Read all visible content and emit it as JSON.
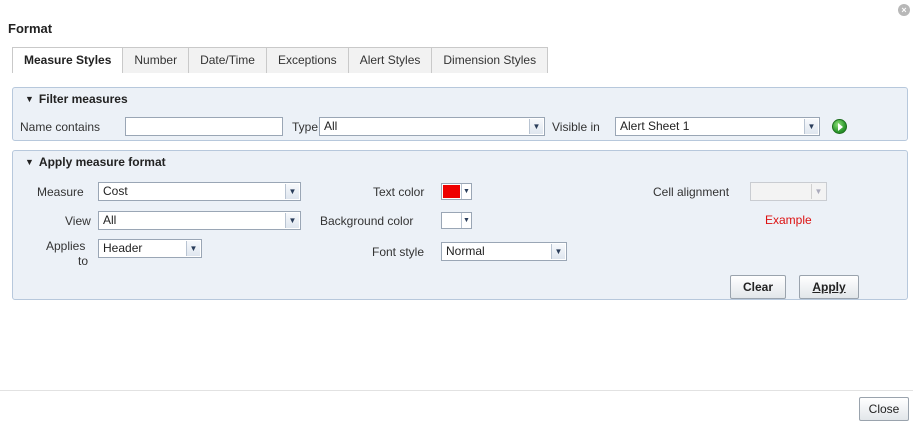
{
  "dialog": {
    "title": "Format",
    "close_icon": "close-circle-icon"
  },
  "tabs": [
    {
      "label": "Measure Styles",
      "active": true
    },
    {
      "label": "Number",
      "active": false
    },
    {
      "label": "Date/Time",
      "active": false
    },
    {
      "label": "Exceptions",
      "active": false
    },
    {
      "label": "Alert Styles",
      "active": false
    },
    {
      "label": "Dimension Styles",
      "active": false
    }
  ],
  "filter": {
    "header": "Filter measures",
    "name_label": "Name contains",
    "name_value": "",
    "type_label": "Type",
    "type_value": "All",
    "visible_label": "Visible in",
    "visible_value": "Alert Sheet 1",
    "go_icon": "go-arrow-icon"
  },
  "apply": {
    "header": "Apply measure format",
    "measure_label": "Measure",
    "measure_value": "Cost",
    "view_label": "View",
    "view_value": "All",
    "applies_label_1": "Applies",
    "applies_label_2": "to",
    "applies_value": "Header",
    "text_color_label": "Text color",
    "text_color": "#ee0000",
    "bg_color_label": "Background color",
    "bg_color": "#ffffff",
    "font_style_label": "Font style",
    "font_style_value": "Normal",
    "cell_alignment_label": "Cell alignment",
    "cell_alignment_value": "",
    "example_text": "Example",
    "clear_label": "Clear",
    "apply_label": "Apply"
  },
  "footer": {
    "close_label": "Close"
  }
}
